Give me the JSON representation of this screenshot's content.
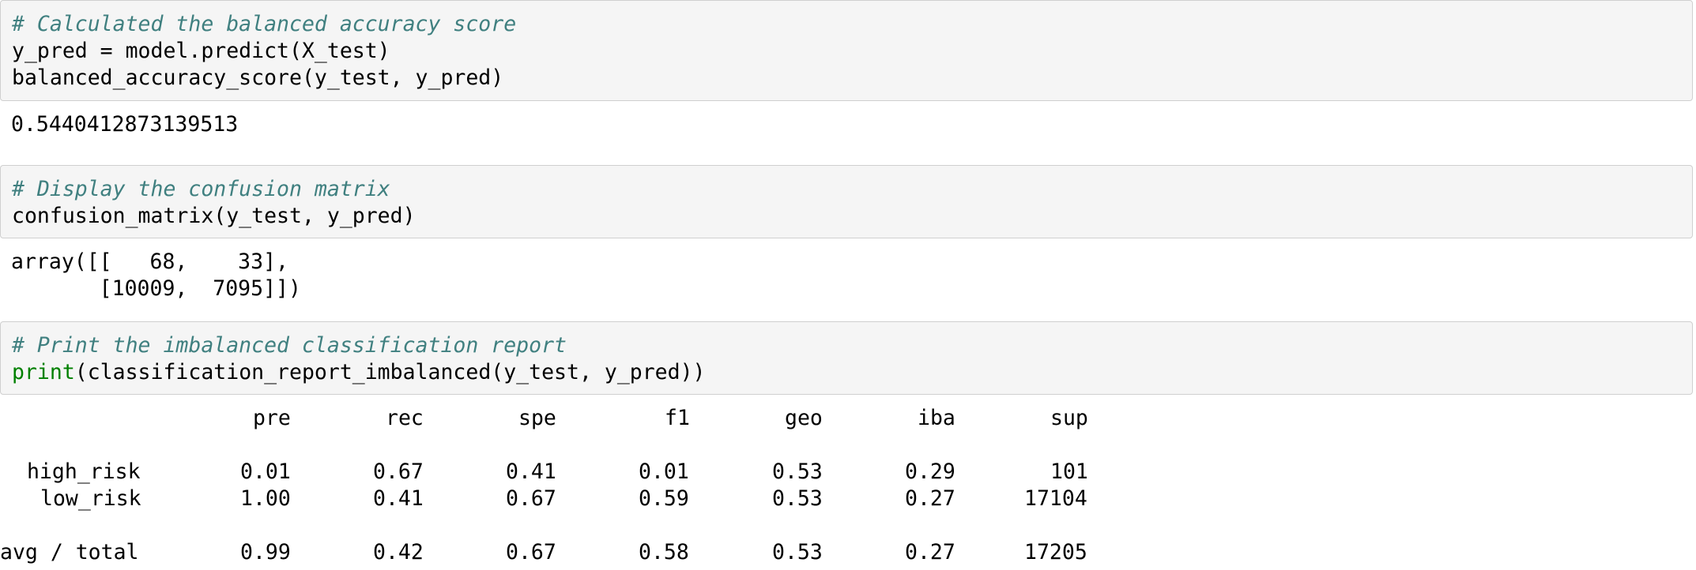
{
  "cells": [
    {
      "input": {
        "comment": "# Calculated the balanced accuracy score",
        "lines": [
          "y_pred = model.predict(X_test)",
          "balanced_accuracy_score(y_test, y_pred)"
        ]
      },
      "output": [
        "0.5440412873139513"
      ]
    },
    {
      "input": {
        "comment": "# Display the confusion matrix",
        "lines": [
          "confusion_matrix(y_test, y_pred)"
        ]
      },
      "output": [
        "array([[   68,    33],",
        "       [10009,  7095]])"
      ]
    },
    {
      "input": {
        "comment": "# Print the imbalanced classification report",
        "builtin": "print",
        "lines": [
          "(classification_report_imbalanced(y_test, y_pred))"
        ]
      },
      "report": {
        "header": [
          "pre",
          "rec",
          "spe",
          "f1",
          "geo",
          "iba",
          "sup"
        ],
        "rows": [
          {
            "label": "high_risk",
            "values": [
              "0.01",
              "0.67",
              "0.41",
              "0.01",
              "0.53",
              "0.29",
              "101"
            ]
          },
          {
            "label": "low_risk",
            "values": [
              "1.00",
              "0.41",
              "0.67",
              "0.59",
              "0.53",
              "0.27",
              "17104"
            ]
          }
        ],
        "total": {
          "label": "avg / total",
          "values": [
            "0.99",
            "0.42",
            "0.67",
            "0.58",
            "0.53",
            "0.27",
            "17205"
          ]
        }
      }
    }
  ]
}
